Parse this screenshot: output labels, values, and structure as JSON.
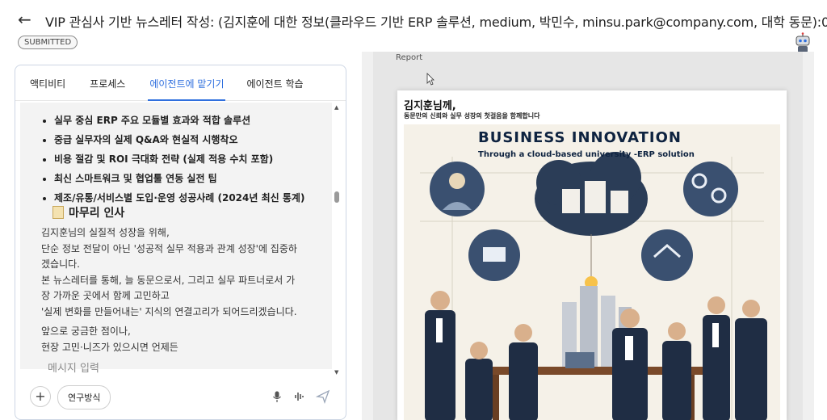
{
  "header": {
    "back_icon": "arrow-left-icon",
    "title": "VIP 관심사 기반 뉴스레터 작성: (김지훈에 대한 정보(클라우드 기반 ERP 솔루션, medium, 박민수, minsu.park@company.com, 대학 동문):0)",
    "status_badge": "SUBMITTED",
    "avatar_icon": "robot-icon"
  },
  "tabs": [
    {
      "label": "액티비티",
      "active": false
    },
    {
      "label": "프로세스",
      "active": false
    },
    {
      "label": "에이전트에 맡기기",
      "active": true
    },
    {
      "label": "에이전트 학습",
      "active": false
    }
  ],
  "chat": {
    "bullets": [
      "실무 중심 ERP 주요 모듈별 효과와 적합 솔루션",
      "중급 실무자의 실제 Q&A와 현실적 시행착오",
      "비용 절감 및 ROI 극대화 전략 (실제 적용 수치 포함)",
      "최신 스마트워크 및 협업툴 연동 실전 팁",
      "제조/유통/서비스별 도입·운영 성공사례 (2024년 최신 통계)"
    ],
    "section_title": "마무리 인사",
    "section_icon": "memo-icon",
    "paragraph1": [
      "김지훈님의 실질적 성장을 위해,",
      "단순 정보 전달이 아닌 '성공적 실무 적용과 관계 성장'에 집중하",
      "겠습니다.",
      "본 뉴스레터를 통해, 늘 동문으로서, 그리고 실무 파트너로서 가",
      "장 가까운 곳에서 함께 고민하고",
      "'실제 변화를 만들어내는' 지식의 연결고리가 되어드리겠습니다."
    ],
    "paragraph2": [
      "앞으로 궁금한 점이나,",
      "현장 고민·니즈가 있으시면 언제든"
    ]
  },
  "composer": {
    "placeholder": "메시지 입력",
    "add_icon": "plus-icon",
    "research_button": "연구방식",
    "mic_icon": "microphone-icon",
    "voice_icon": "waveform-icon",
    "send_icon": "send-icon"
  },
  "report": {
    "label": "Report",
    "greeting": "김지훈님께,",
    "greeting_sub": "동문만의 신뢰와 실무 성장의 첫걸음을 함께합니다",
    "poster_title": "BUSINESS INNOVATION",
    "poster_subtitle": "Through a cloud-based university -ERP solution"
  },
  "colors": {
    "accent": "#2f6fde",
    "poster_navy": "#0e2340",
    "cloud_dark": "#2b3d57"
  }
}
